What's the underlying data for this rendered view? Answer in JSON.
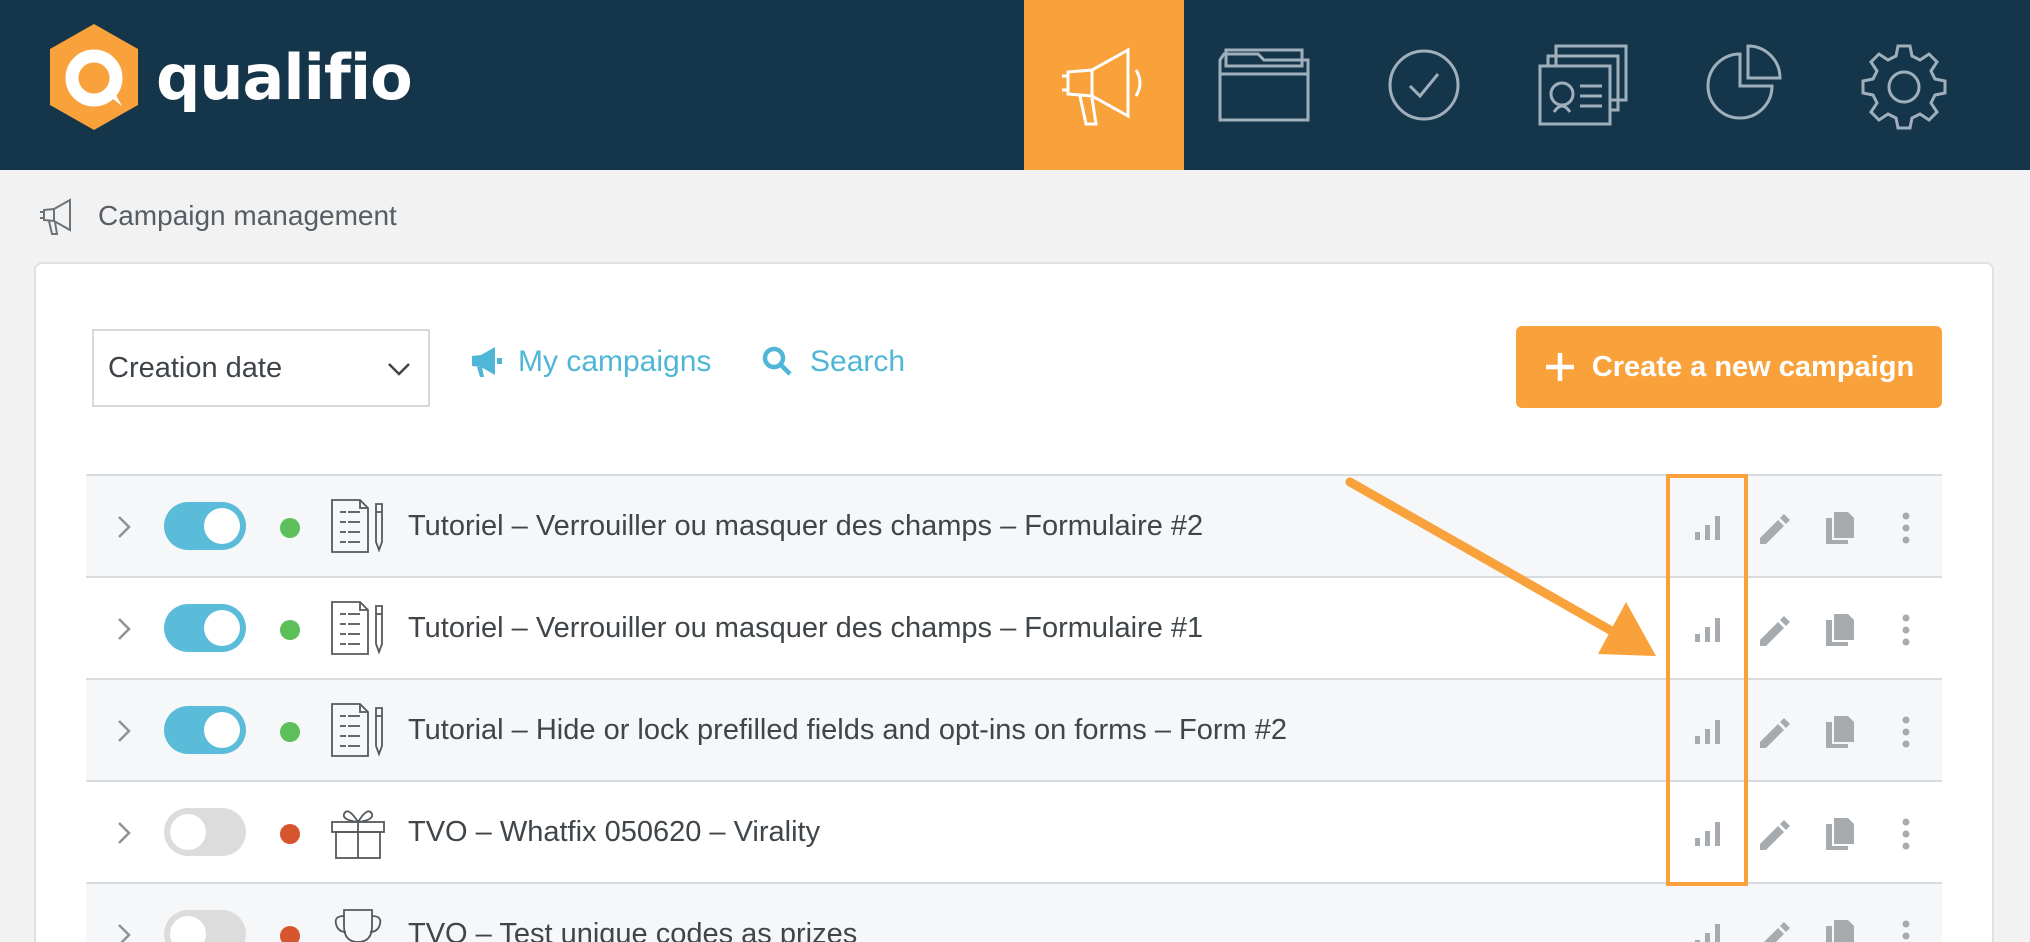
{
  "header": {
    "logo_text": "qualifio",
    "nav": [
      {
        "name": "campaigns",
        "icon": "megaphone-icon",
        "active": true
      },
      {
        "name": "folders",
        "icon": "folder-icon",
        "active": false
      },
      {
        "name": "validation",
        "icon": "check-circle-icon",
        "active": false
      },
      {
        "name": "contacts",
        "icon": "id-card-icon",
        "active": false
      },
      {
        "name": "statistics",
        "icon": "pie-chart-icon",
        "active": false
      },
      {
        "name": "settings",
        "icon": "gear-icon",
        "active": false
      }
    ]
  },
  "page": {
    "title": "Campaign management"
  },
  "toolbar": {
    "sort_value": "Creation date",
    "my_campaigns_label": "My campaigns",
    "search_label": "Search",
    "create_label": "Create a new campaign"
  },
  "campaigns": [
    {
      "title": "Tutoriel – Verrouiller ou masquer des champs – Formulaire #2",
      "enabled": true,
      "status": "active",
      "type_icon": "form-icon"
    },
    {
      "title": "Tutoriel – Verrouiller ou masquer des champs – Formulaire #1",
      "enabled": true,
      "status": "active",
      "type_icon": "form-icon"
    },
    {
      "title": "Tutorial – Hide or lock prefilled fields and opt-ins on forms – Form #2",
      "enabled": true,
      "status": "active",
      "type_icon": "form-icon"
    },
    {
      "title": "TVO – Whatfix 050620 – Virality",
      "enabled": false,
      "status": "inactive",
      "type_icon": "gift-icon"
    },
    {
      "title": "TVO – Test unique codes as prizes",
      "enabled": false,
      "status": "inactive",
      "type_icon": "trophy-icon"
    }
  ],
  "colors": {
    "topbar": "#15364a",
    "accent": "#f9a13a",
    "link": "#4fb6d7",
    "status_active": "#5cbf5a",
    "status_inactive": "#d6552f"
  }
}
